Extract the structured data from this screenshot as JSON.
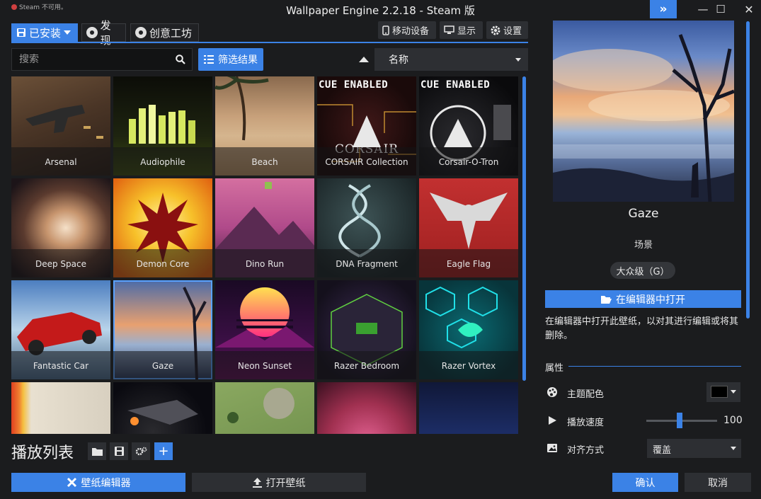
{
  "titlebar": {
    "steam_warning": "Steam 不可用。",
    "title": "Wallpaper Engine 2.2.18 - Steam 版",
    "expand_icon": "»",
    "minimize_icon": "—",
    "maximize_icon": "☐",
    "close_icon": "✕"
  },
  "tabs": [
    {
      "label": "已安装",
      "active": true
    },
    {
      "label": "发现",
      "active": false
    },
    {
      "label": "创意工坊",
      "active": false
    }
  ],
  "toolbar": {
    "mobile_label": "移动设备",
    "display_label": "显示",
    "settings_label": "设置"
  },
  "search": {
    "placeholder": "搜索"
  },
  "filter": {
    "label": "筛选结果"
  },
  "sort": {
    "value": "名称"
  },
  "wallpapers": [
    {
      "title": "Arsenal"
    },
    {
      "title": "Audiophile"
    },
    {
      "title": "Beach"
    },
    {
      "title": "CORSAIR Collection",
      "badge": "CUE ENABLED",
      "brand": "CORSAIR"
    },
    {
      "title": "Corsair-O-Tron",
      "badge": "CUE ENABLED"
    },
    {
      "title": "Deep Space"
    },
    {
      "title": "Demon Core"
    },
    {
      "title": "Dino Run"
    },
    {
      "title": "DNA Fragment"
    },
    {
      "title": "Eagle Flag"
    },
    {
      "title": "Fantastic Car"
    },
    {
      "title": "Gaze",
      "selected": true
    },
    {
      "title": "Neon Sunset"
    },
    {
      "title": "Razer Bedroom"
    },
    {
      "title": "Razer Vortex"
    },
    {
      "title": ""
    },
    {
      "title": ""
    },
    {
      "title": ""
    },
    {
      "title": ""
    },
    {
      "title": ""
    }
  ],
  "playlist": {
    "title": "播放列表",
    "add_icon": "+"
  },
  "bottom": {
    "editor_label": "壁纸编辑器",
    "open_label": "打开壁纸",
    "confirm_label": "确认",
    "cancel_label": "取消"
  },
  "details": {
    "title": "Gaze",
    "type": "场景",
    "rating": "大众级（G）",
    "open_in_editor": "在编辑器中打开",
    "editor_desc": "在编辑器中打开此壁纸，以对其进行编辑或将其删除。",
    "properties_header": "属性",
    "properties": {
      "color_label": "主题配色",
      "color_value": "#000000",
      "speed_label": "播放速度",
      "speed_value": "100",
      "align_label": "对齐方式",
      "align_value": "覆盖"
    }
  }
}
